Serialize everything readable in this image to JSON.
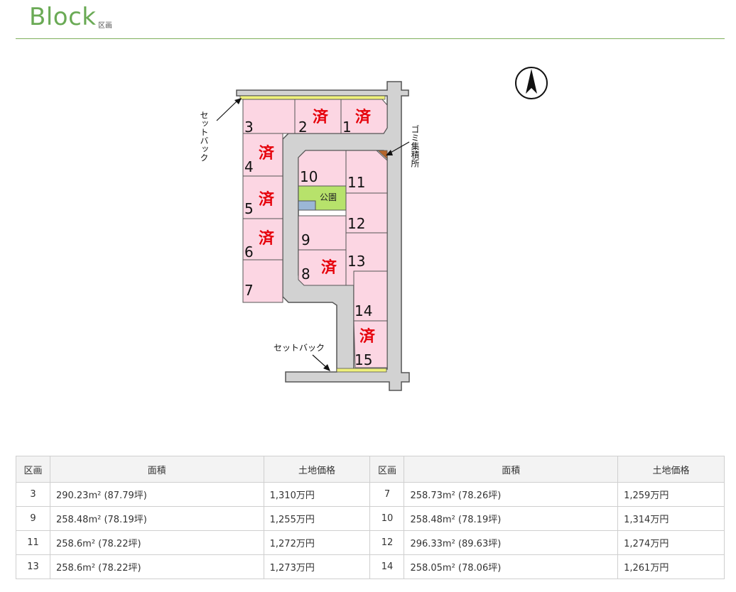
{
  "header": {
    "title": "Block",
    "subtitle": "区画"
  },
  "map": {
    "lots": [
      {
        "no": "3",
        "sold": false
      },
      {
        "no": "2",
        "sold": true
      },
      {
        "no": "1",
        "sold": true
      },
      {
        "no": "4",
        "sold": true
      },
      {
        "no": "5",
        "sold": true
      },
      {
        "no": "6",
        "sold": true
      },
      {
        "no": "7",
        "sold": false
      },
      {
        "no": "10",
        "sold": false
      },
      {
        "no": "11",
        "sold": false
      },
      {
        "no": "12",
        "sold": false
      },
      {
        "no": "9",
        "sold": false
      },
      {
        "no": "8",
        "sold": true
      },
      {
        "no": "13",
        "sold": false
      },
      {
        "no": "14",
        "sold": false
      },
      {
        "no": "15",
        "sold": true
      }
    ],
    "sold_mark": "済",
    "park_label": "公園",
    "setback_label": "セットバック",
    "garbage_label": "ゴミ集積所",
    "north_icon": "north-arrow-icon",
    "colors": {
      "lot": "#fcd6e3",
      "road": "#d2d2d2",
      "park": "#b7e26b",
      "setback": "#eef07a",
      "sold": "#e6000a",
      "accent": "#6aaa55"
    }
  },
  "table": {
    "headers": [
      "区画",
      "面積",
      "土地価格",
      "区画",
      "面積",
      "土地価格"
    ],
    "rows": [
      [
        "3",
        "290.23m² (87.79坪)",
        "1,310万円",
        "7",
        "258.73m² (78.26坪)",
        "1,259万円"
      ],
      [
        "9",
        "258.48m² (78.19坪)",
        "1,255万円",
        "10",
        "258.48m² (78.19坪)",
        "1,314万円"
      ],
      [
        "11",
        "258.6m² (78.22坪)",
        "1,272万円",
        "12",
        "296.33m² (89.63坪)",
        "1,274万円"
      ],
      [
        "13",
        "258.6m² (78.22坪)",
        "1,273万円",
        "14",
        "258.05m² (78.06坪)",
        "1,261万円"
      ]
    ]
  }
}
